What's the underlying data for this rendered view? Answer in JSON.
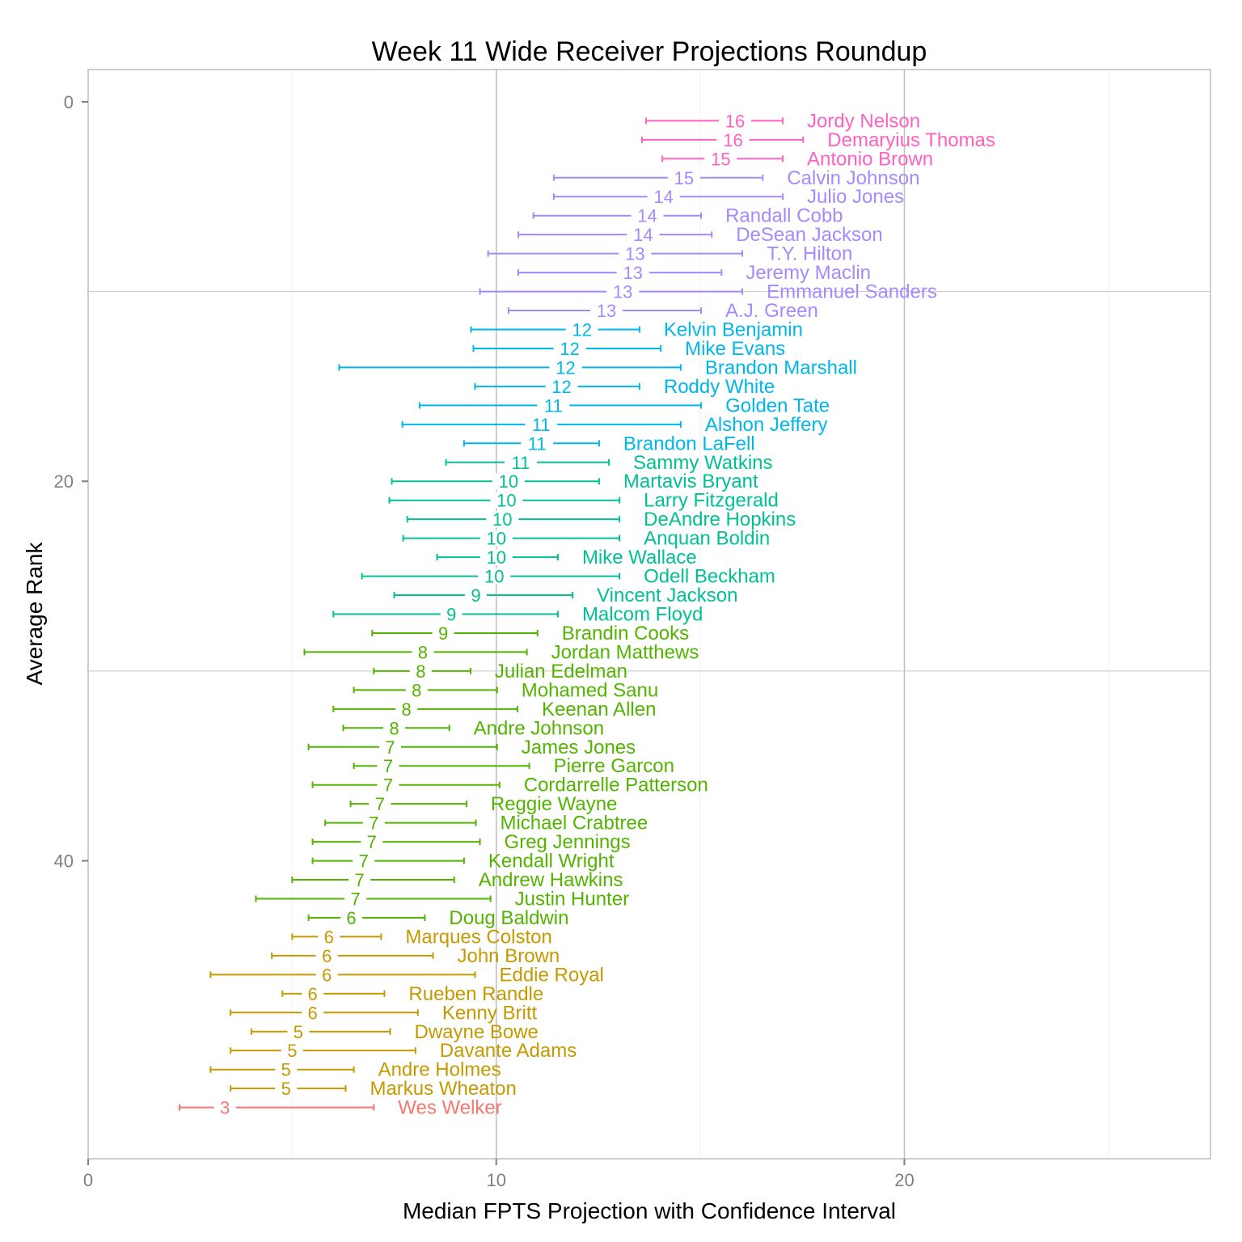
{
  "chart_data": {
    "type": "errorbar",
    "title": "Week 11 Wide Receiver Projections Roundup",
    "xlabel": "Median FPTS Projection with Confidence Interval",
    "ylabel": "Average Rank",
    "xlim": [
      0,
      27.5
    ],
    "ylim": [
      55.7,
      -1.7
    ],
    "x_ticks": [
      0,
      10,
      20
    ],
    "y_ticks": [
      0,
      20,
      40
    ],
    "x_gridlines_major": [
      10,
      20
    ],
    "x_gridlines_minor": [
      5,
      15,
      25
    ],
    "y_gridlines": [
      10,
      30
    ],
    "legend": "none",
    "tiers": [
      {
        "tier": 1,
        "color": "#FF61C3"
      },
      {
        "tier": 2,
        "color": "#A58AFF"
      },
      {
        "tier": 3,
        "color": "#00B6EB"
      },
      {
        "tier": 4,
        "color": "#00C094"
      },
      {
        "tier": 5,
        "color": "#53B400"
      },
      {
        "tier": 6,
        "color": "#C49A00"
      },
      {
        "tier": 7,
        "color": "#F8766D"
      }
    ],
    "players": [
      {
        "rank": 1,
        "name": "Jordy Nelson",
        "median": 15.85,
        "label": "16",
        "lower": 13.67,
        "upper": 17.02,
        "tier": 1
      },
      {
        "rank": 2,
        "name": "Demaryius Thomas",
        "median": 15.8,
        "label": "16",
        "lower": 13.57,
        "upper": 17.52,
        "tier": 1
      },
      {
        "rank": 3,
        "name": "Antonio Brown",
        "median": 15.5,
        "label": "15",
        "lower": 14.07,
        "upper": 17.02,
        "tier": 1
      },
      {
        "rank": 4,
        "name": "Calvin Johnson",
        "median": 14.6,
        "label": "15",
        "lower": 11.41,
        "upper": 16.53,
        "tier": 2
      },
      {
        "rank": 5,
        "name": "Julio Jones",
        "median": 14.1,
        "label": "14",
        "lower": 11.41,
        "upper": 17.02,
        "tier": 2
      },
      {
        "rank": 6,
        "name": "Randall Cobb",
        "median": 13.7,
        "label": "14",
        "lower": 10.91,
        "upper": 15.02,
        "tier": 2
      },
      {
        "rank": 7,
        "name": "DeSean Jackson",
        "median": 13.6,
        "label": "14",
        "lower": 10.54,
        "upper": 15.28,
        "tier": 2
      },
      {
        "rank": 8,
        "name": "T.Y. Hilton",
        "median": 13.4,
        "label": "13",
        "lower": 9.8,
        "upper": 16.03,
        "tier": 2
      },
      {
        "rank": 9,
        "name": "Jeremy Maclin",
        "median": 13.35,
        "label": "13",
        "lower": 10.54,
        "upper": 15.52,
        "tier": 2
      },
      {
        "rank": 10,
        "name": "Emmanuel Sanders",
        "median": 13.1,
        "label": "13",
        "lower": 9.6,
        "upper": 16.03,
        "tier": 2
      },
      {
        "rank": 11,
        "name": "A.J. Green",
        "median": 12.7,
        "label": "13",
        "lower": 10.3,
        "upper": 15.02,
        "tier": 2
      },
      {
        "rank": 12,
        "name": "Kelvin Benjamin",
        "median": 12.1,
        "label": "12",
        "lower": 9.38,
        "upper": 13.51,
        "tier": 3
      },
      {
        "rank": 13,
        "name": "Mike Evans",
        "median": 11.8,
        "label": "12",
        "lower": 9.44,
        "upper": 14.03,
        "tier": 3
      },
      {
        "rank": 14,
        "name": "Brandon Marshall",
        "median": 11.7,
        "label": "12",
        "lower": 6.15,
        "upper": 14.52,
        "tier": 3
      },
      {
        "rank": 15,
        "name": "Roddy White",
        "median": 11.6,
        "label": "12",
        "lower": 9.48,
        "upper": 13.51,
        "tier": 3
      },
      {
        "rank": 16,
        "name": "Golden Tate",
        "median": 11.4,
        "label": "11",
        "lower": 8.12,
        "upper": 15.02,
        "tier": 3
      },
      {
        "rank": 17,
        "name": "Alshon Jeffery",
        "median": 11.1,
        "label": "11",
        "lower": 7.7,
        "upper": 14.52,
        "tier": 3
      },
      {
        "rank": 18,
        "name": "Brandon LaFell",
        "median": 11.0,
        "label": "11",
        "lower": 9.21,
        "upper": 12.52,
        "tier": 3
      },
      {
        "rank": 19,
        "name": "Sammy Watkins",
        "median": 10.6,
        "label": "11",
        "lower": 8.77,
        "upper": 12.76,
        "tier": 4
      },
      {
        "rank": 20,
        "name": "Martavis Bryant",
        "median": 10.3,
        "label": "10",
        "lower": 7.44,
        "upper": 12.52,
        "tier": 4
      },
      {
        "rank": 21,
        "name": "Larry Fitzgerald",
        "median": 10.25,
        "label": "10",
        "lower": 7.38,
        "upper": 13.02,
        "tier": 4
      },
      {
        "rank": 22,
        "name": "DeAndre Hopkins",
        "median": 10.15,
        "label": "10",
        "lower": 7.82,
        "upper": 13.02,
        "tier": 4
      },
      {
        "rank": 23,
        "name": "Anquan Boldin",
        "median": 10.0,
        "label": "10",
        "lower": 7.72,
        "upper": 13.02,
        "tier": 4
      },
      {
        "rank": 24,
        "name": "Mike Wallace",
        "median": 10.0,
        "label": "10",
        "lower": 8.55,
        "upper": 11.51,
        "tier": 4
      },
      {
        "rank": 25,
        "name": "Odell Beckham",
        "median": 9.95,
        "label": "10",
        "lower": 6.71,
        "upper": 13.02,
        "tier": 4
      },
      {
        "rank": 26,
        "name": "Vincent Jackson",
        "median": 9.5,
        "label": "9",
        "lower": 7.5,
        "upper": 11.87,
        "tier": 4
      },
      {
        "rank": 27,
        "name": "Malcom Floyd",
        "median": 8.9,
        "label": "9",
        "lower": 6.01,
        "upper": 11.51,
        "tier": 4
      },
      {
        "rank": 28,
        "name": "Brandin Cooks",
        "median": 8.7,
        "label": "9",
        "lower": 6.96,
        "upper": 11.01,
        "tier": 5
      },
      {
        "rank": 29,
        "name": "Jordan Matthews",
        "median": 8.2,
        "label": "8",
        "lower": 5.3,
        "upper": 10.75,
        "tier": 5
      },
      {
        "rank": 30,
        "name": "Julian Edelman",
        "median": 8.15,
        "label": "8",
        "lower": 7.0,
        "upper": 9.37,
        "tier": 5
      },
      {
        "rank": 31,
        "name": "Mohamed Sanu",
        "median": 8.05,
        "label": "8",
        "lower": 6.51,
        "upper": 10.02,
        "tier": 5
      },
      {
        "rank": 32,
        "name": "Keenan Allen",
        "median": 7.8,
        "label": "8",
        "lower": 6.01,
        "upper": 10.52,
        "tier": 5
      },
      {
        "rank": 33,
        "name": "Andre Johnson",
        "median": 7.5,
        "label": "8",
        "lower": 6.25,
        "upper": 8.85,
        "tier": 5
      },
      {
        "rank": 34,
        "name": "James Jones",
        "median": 7.4,
        "label": "7",
        "lower": 5.4,
        "upper": 10.02,
        "tier": 5
      },
      {
        "rank": 35,
        "name": "Pierre Garcon",
        "median": 7.35,
        "label": "7",
        "lower": 6.51,
        "upper": 10.81,
        "tier": 5
      },
      {
        "rank": 36,
        "name": "Cordarrelle Patterson",
        "median": 7.35,
        "label": "7",
        "lower": 5.5,
        "upper": 10.08,
        "tier": 5
      },
      {
        "rank": 37,
        "name": "Reggie Wayne",
        "median": 7.15,
        "label": "7",
        "lower": 6.43,
        "upper": 9.27,
        "tier": 5
      },
      {
        "rank": 38,
        "name": "Michael Crabtree",
        "median": 7.0,
        "label": "7",
        "lower": 5.81,
        "upper": 9.5,
        "tier": 5
      },
      {
        "rank": 39,
        "name": "Greg Jennings",
        "median": 6.95,
        "label": "7",
        "lower": 5.5,
        "upper": 9.6,
        "tier": 5
      },
      {
        "rank": 40,
        "name": "Kendall Wright",
        "median": 6.75,
        "label": "7",
        "lower": 5.5,
        "upper": 9.21,
        "tier": 5
      },
      {
        "rank": 41,
        "name": "Andrew Hawkins",
        "median": 6.65,
        "label": "7",
        "lower": 5.0,
        "upper": 8.97,
        "tier": 5
      },
      {
        "rank": 42,
        "name": "Justin Hunter",
        "median": 6.55,
        "label": "7",
        "lower": 4.11,
        "upper": 9.86,
        "tier": 5
      },
      {
        "rank": 43,
        "name": "Doug Baldwin",
        "median": 6.45,
        "label": "6",
        "lower": 5.4,
        "upper": 8.25,
        "tier": 5
      },
      {
        "rank": 44,
        "name": "Marques Colston",
        "median": 5.9,
        "label": "6",
        "lower": 5.0,
        "upper": 7.18,
        "tier": 6
      },
      {
        "rank": 45,
        "name": "John Brown",
        "median": 5.85,
        "label": "6",
        "lower": 4.5,
        "upper": 8.45,
        "tier": 6
      },
      {
        "rank": 46,
        "name": "Eddie Royal",
        "median": 5.85,
        "label": "6",
        "lower": 3.0,
        "upper": 9.48,
        "tier": 6
      },
      {
        "rank": 47,
        "name": "Rueben Randle",
        "median": 5.5,
        "label": "6",
        "lower": 4.76,
        "upper": 7.26,
        "tier": 6
      },
      {
        "rank": 48,
        "name": "Kenny Britt",
        "median": 5.5,
        "label": "6",
        "lower": 3.49,
        "upper": 8.08,
        "tier": 6
      },
      {
        "rank": 49,
        "name": "Dwayne Bowe",
        "median": 5.15,
        "label": "5",
        "lower": 4.0,
        "upper": 7.4,
        "tier": 6
      },
      {
        "rank": 50,
        "name": "Davante Adams",
        "median": 5.0,
        "label": "5",
        "lower": 3.49,
        "upper": 8.02,
        "tier": 6
      },
      {
        "rank": 51,
        "name": "Andre Holmes",
        "median": 4.85,
        "label": "5",
        "lower": 3.0,
        "upper": 6.51,
        "tier": 6
      },
      {
        "rank": 52,
        "name": "Markus Wheaton",
        "median": 4.85,
        "label": "5",
        "lower": 3.49,
        "upper": 6.31,
        "tier": 6
      },
      {
        "rank": 53,
        "name": "Wes Welker",
        "median": 3.35,
        "label": "3",
        "lower": 2.24,
        "upper": 7.0,
        "tier": 7
      }
    ]
  }
}
